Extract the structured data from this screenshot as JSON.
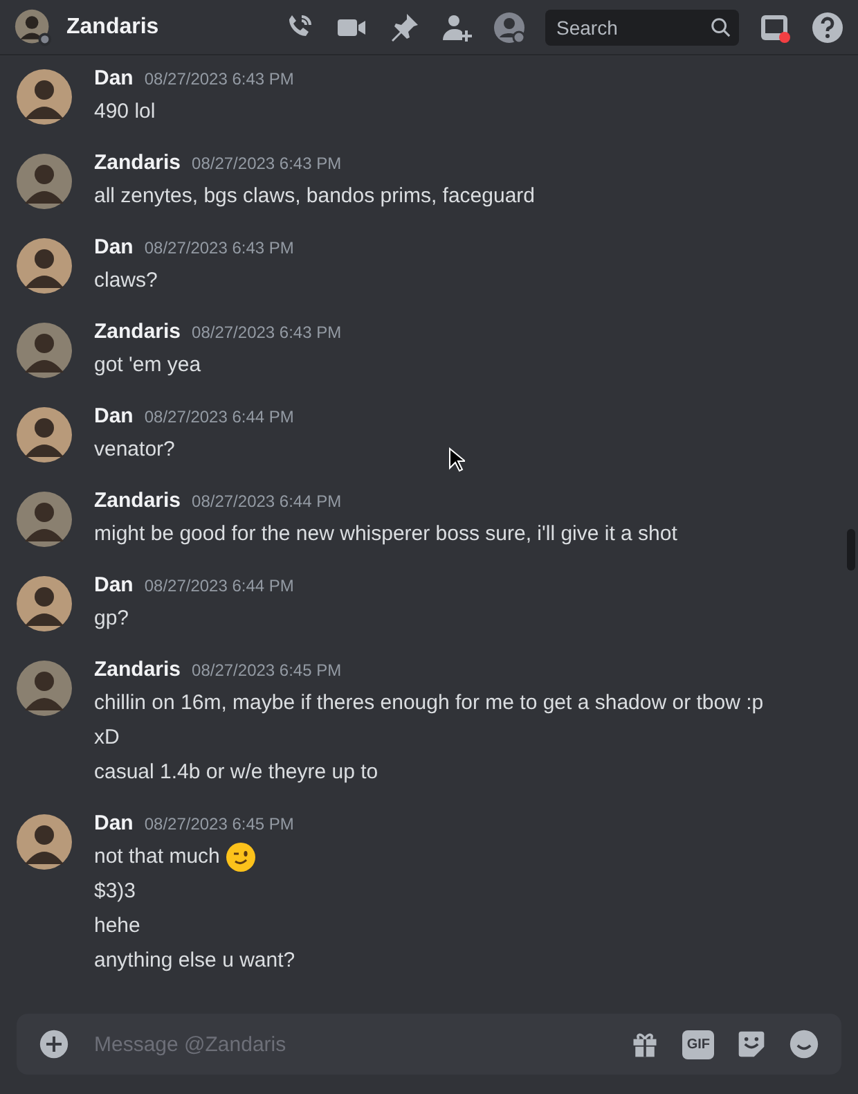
{
  "header": {
    "title": "Zandaris",
    "search": {
      "placeholder": "Search"
    }
  },
  "messages": [
    {
      "author": "Dan",
      "color": "#b89a7a",
      "time": "08/27/2023 6:43 PM",
      "lines": [
        {
          "text": "490 lol"
        }
      ]
    },
    {
      "author": "Zandaris",
      "color": "#8a8070",
      "time": "08/27/2023 6:43 PM",
      "lines": [
        {
          "text": "all zenytes, bgs claws, bandos prims, faceguard"
        }
      ]
    },
    {
      "author": "Dan",
      "color": "#b89a7a",
      "time": "08/27/2023 6:43 PM",
      "lines": [
        {
          "text": "claws?"
        }
      ]
    },
    {
      "author": "Zandaris",
      "color": "#8a8070",
      "time": "08/27/2023 6:43 PM",
      "lines": [
        {
          "text": "got 'em yea"
        }
      ]
    },
    {
      "author": "Dan",
      "color": "#b89a7a",
      "time": "08/27/2023 6:44 PM",
      "lines": [
        {
          "text": "venator?"
        }
      ]
    },
    {
      "author": "Zandaris",
      "color": "#8a8070",
      "time": "08/27/2023 6:44 PM",
      "lines": [
        {
          "text": "might be good for the new whisperer boss sure, i'll give it a shot"
        }
      ]
    },
    {
      "author": "Dan",
      "color": "#b89a7a",
      "time": "08/27/2023 6:44 PM",
      "lines": [
        {
          "text": "gp?"
        }
      ]
    },
    {
      "author": "Zandaris",
      "color": "#8a8070",
      "time": "08/27/2023 6:45 PM",
      "lines": [
        {
          "text": "chillin on 16m, maybe if theres enough for me to get a shadow or tbow :p"
        },
        {
          "text": "xD"
        },
        {
          "text": "casual 1.4b or w/e theyre up to"
        }
      ]
    },
    {
      "author": "Dan",
      "color": "#b89a7a",
      "time": "08/27/2023 6:45 PM",
      "lines": [
        {
          "text": "not that much",
          "emoji": true
        },
        {
          "text": "$3)3"
        },
        {
          "text": "hehe"
        },
        {
          "text": "anything else u want?"
        }
      ]
    }
  ],
  "composer": {
    "placeholder": "Message @Zandaris",
    "gif": "GIF"
  }
}
